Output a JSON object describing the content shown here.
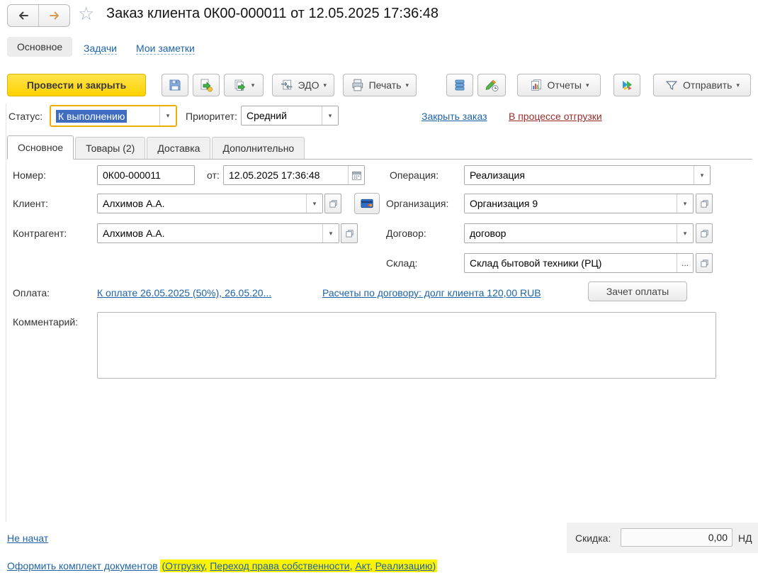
{
  "header": {
    "title": "Заказ клиента 0К00-000011 от 12.05.2025 17:36:48",
    "sections": {
      "main": "Основное",
      "tasks": "Задачи",
      "notes": "Мои заметки"
    }
  },
  "toolbar": {
    "post_and_close": "Провести и закрыть",
    "edo": "ЭДО",
    "print": "Печать",
    "reports": "Отчеты",
    "send": "Отправить"
  },
  "status": {
    "label": "Статус:",
    "value": "К выполнению",
    "priority_label": "Приоритет:",
    "priority_value": "Средний",
    "close_order": "Закрыть заказ",
    "shipment_state": "В процессе отгрузки"
  },
  "tabs": {
    "main": "Основное",
    "goods": "Товары (2)",
    "delivery": "Доставка",
    "extra": "Дополнительно"
  },
  "form": {
    "number": {
      "label": "Номер:",
      "value": "0К00-000011"
    },
    "date": {
      "label": "от:",
      "value": "12.05.2025 17:36:48"
    },
    "operation": {
      "label": "Операция:",
      "value": "Реализация"
    },
    "client": {
      "label": "Клиент:",
      "value": "Алхимов А.А."
    },
    "counterparty": {
      "label": "Контрагент:",
      "value": "Алхимов А.А."
    },
    "organization": {
      "label": "Организация:",
      "value": "Организация 9"
    },
    "contract": {
      "label": "Договор:",
      "value": "договор"
    },
    "warehouse": {
      "label": "Склад:",
      "value": "Склад бытовой техники (РЦ)",
      "ellipsis": "..."
    },
    "payment": {
      "label": "Оплата:",
      "schedule_link": "К оплате 26.05.2025 (50%), 26.05.20...",
      "settlements_link": "Расчеты по договору: долг клиента 120,00 RUB",
      "offset_button": "Зачет оплаты"
    },
    "comment": {
      "label": "Комментарий:"
    }
  },
  "footer": {
    "progress_link": "Не начат",
    "discount": {
      "label": "Скидка:",
      "value": "0,00"
    },
    "vat_clipped": "НД",
    "docs": {
      "link": "Оформить комплект документов",
      "open": "(",
      "items": [
        "Отгрузку",
        "Переход права собственности",
        "Акт",
        "Реализацию"
      ],
      "sep": ", ",
      "close": ")"
    }
  },
  "colors": {
    "primary_button": "#ffd400",
    "focus_border": "#eead00",
    "selection": "#3d6cc0",
    "link": "#1e63a8",
    "alert_link": "#9c2b2b",
    "operation_field_bg": "#f8e2b0",
    "docs_highlight": "#fdf200"
  }
}
